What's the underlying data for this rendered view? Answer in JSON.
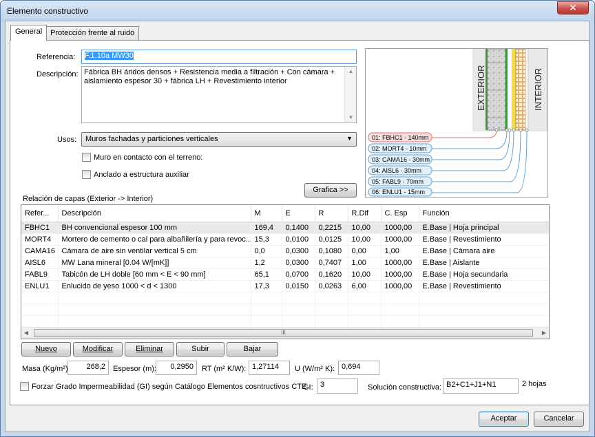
{
  "window": {
    "title": "Elemento constructivo",
    "close": "✕"
  },
  "tabs": [
    "General",
    "Protección frente al ruido"
  ],
  "form": {
    "referencia_label": "Referencia:",
    "referencia_value": "F.1.10a MW30",
    "descripcion_label": "Descripción:",
    "descripcion_value": "Fábrica BH áridos densos + Resistencia media a filtración + Con cámara + aislamiento espesor 30 + fábrica LH + Revestimiento interior",
    "usos_label": "Usos:",
    "usos_value": "Muros fachadas y particiones verticales",
    "cb_terreno": "Muro en contacto con el terreno:",
    "cb_anclado": "Anclado a estructura auxiliar",
    "grafica_button": "Grafica >>",
    "relacion_label": "Relación de capas (Exterior -> Interior)"
  },
  "diagram": {
    "exterior": "EXTERIOR",
    "interior": "INTERIOR",
    "layers": [
      "01: FBHC1 - 140mm",
      "02: MORT4 - 10mm",
      "03: CAMA16 - 30mm",
      "04: AISL6 - 30mm",
      "05: FABL9 - 70mm",
      "06: ENLU1 - 15mm"
    ],
    "colors": {
      "highlight": "#e07070",
      "line": "#5aa0d8"
    }
  },
  "table": {
    "headers": [
      "Refer...",
      "Descripción",
      "M",
      "E",
      "R",
      "R.Dif",
      "C. Esp",
      "Función"
    ],
    "rows": [
      [
        "FBHC1",
        "BH convencional espesor 100 mm",
        "169,4",
        "0,1400",
        "0,2215",
        "10,00",
        "1000,00",
        "E.Base | Hoja principal"
      ],
      [
        "MORT4",
        "Mortero de cemento o cal para albañilería y para revoc...",
        "15,3",
        "0,0100",
        "0,0125",
        "10,00",
        "1000,00",
        "E.Base | Revestimiento"
      ],
      [
        "CAMA16",
        "Cámara de aire sin ventilar vertical 5 cm",
        "0,0",
        "0,0300",
        "0,1080",
        "0,00",
        "1,00",
        "E.Base | Cámara aire"
      ],
      [
        "AISL6",
        "MW Lana mineral [0.04 W/[mK]]",
        "1,2",
        "0,0300",
        "0,7407",
        "1,00",
        "1000,00",
        "E.Base | Aislante"
      ],
      [
        "FABL9",
        "Tabicón de LH doble [60 mm < E < 90 mm]",
        "65,1",
        "0,0700",
        "0,1620",
        "10,00",
        "1000,00",
        "E.Base | Hoja secundaria"
      ],
      [
        "ENLU1",
        "Enlucido de yeso 1000 < d < 1300",
        "17,3",
        "0,0150",
        "0,0263",
        "6,00",
        "1000,00",
        "E.Base | Revestimiento"
      ]
    ],
    "scroll_grip": "III"
  },
  "actions": {
    "nuevo": "Nuevo",
    "modificar": "Modificar",
    "eliminar": "Eliminar",
    "subir": "Subir",
    "bajar": "Bajar"
  },
  "summary": {
    "masa_label": "Masa (Kg/m²):",
    "masa_value": "268,2",
    "espesor_label": "Espesor (m):",
    "espesor_value": "0,2950",
    "rt_label": "RT (m² K/W):",
    "rt_value": "1,27114",
    "u_label": "U (W/m² K):",
    "u_value": "0,694",
    "forzar_label": "Forzar Grado Impermeabilidad (GI) según Catálogo Elementos cosntructivos CTE",
    "gi_label": "GI:",
    "gi_value": "3",
    "solucion_label": "Solución constructiva:",
    "solucion_value": "B2+C1+J1+N1",
    "hojas": "2 hojas"
  },
  "footer": {
    "aceptar": "Aceptar",
    "cancelar": "Cancelar"
  }
}
